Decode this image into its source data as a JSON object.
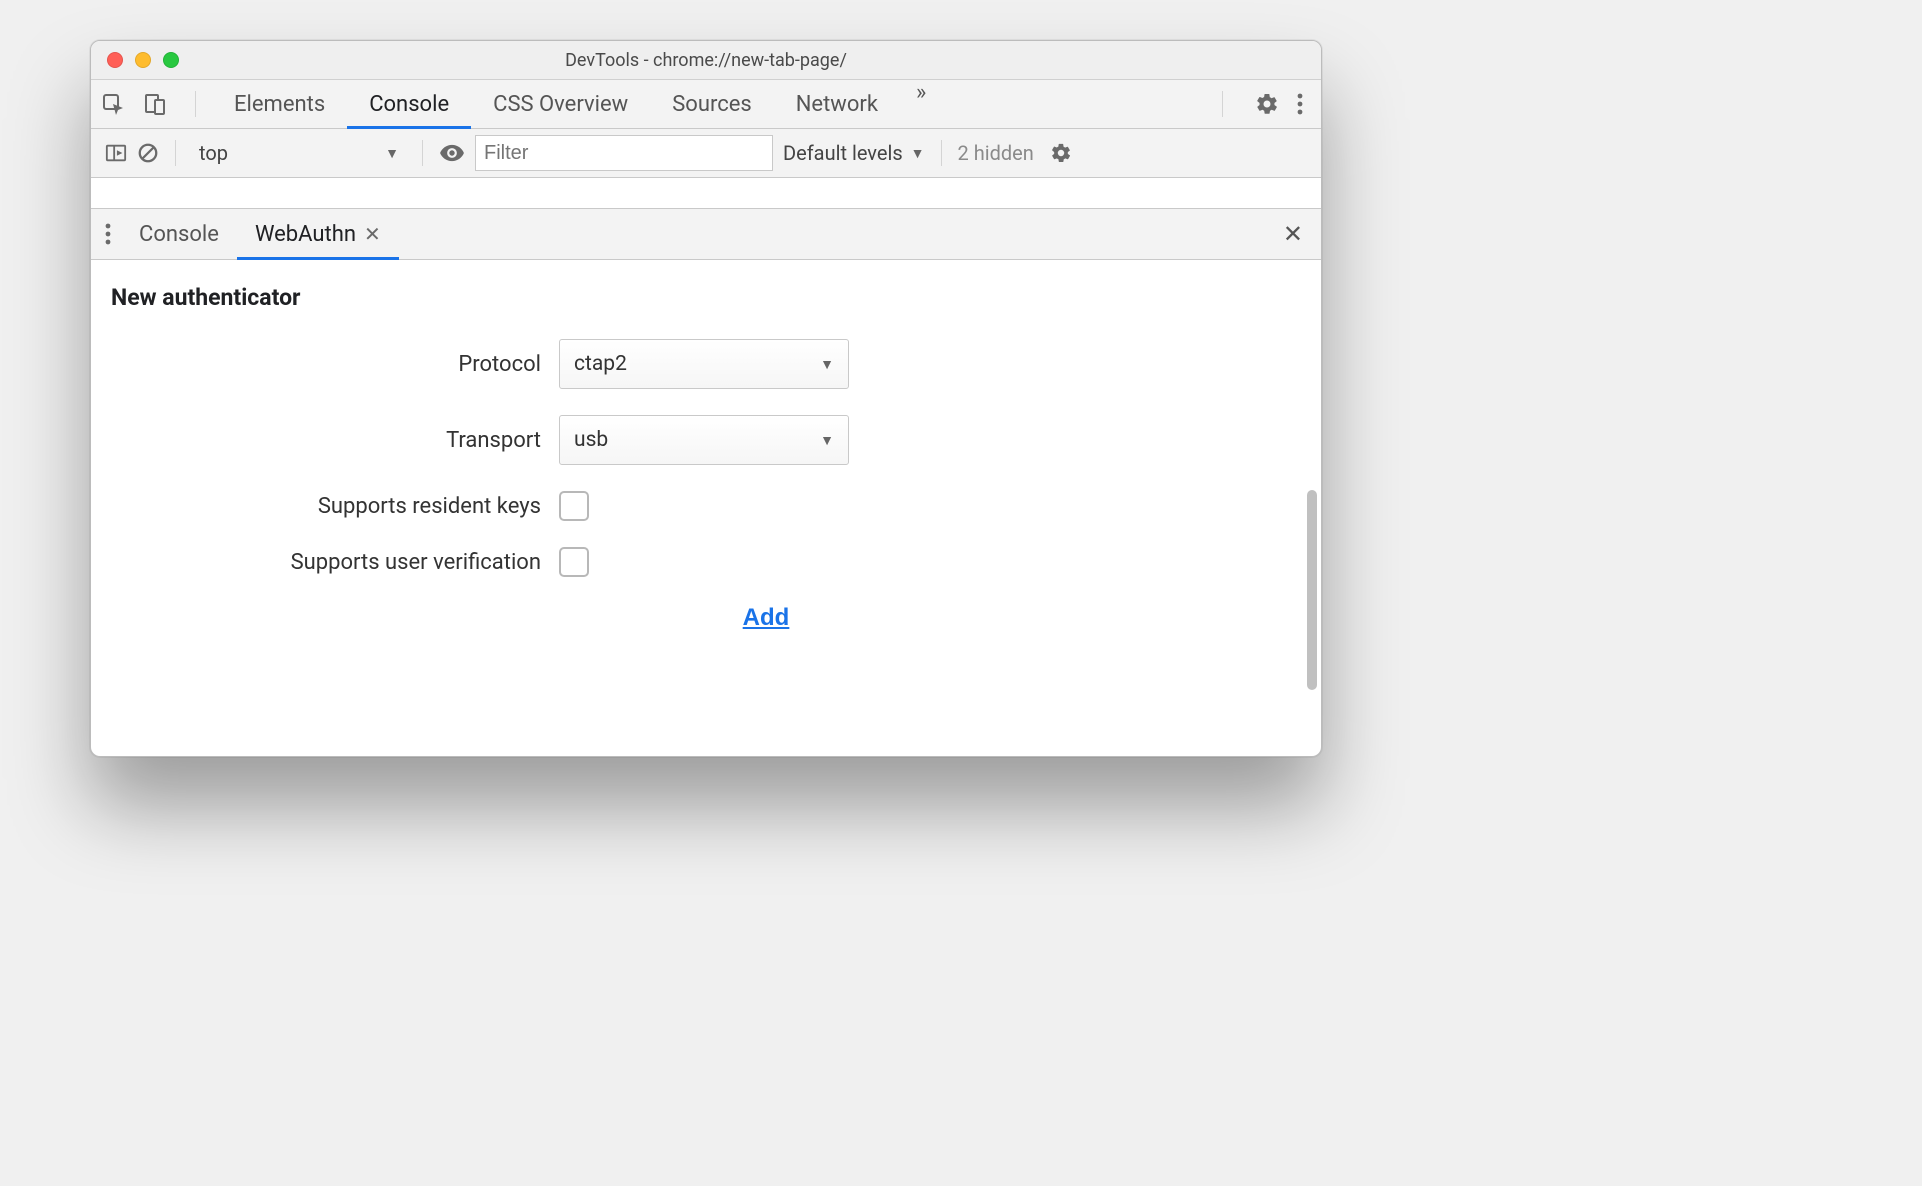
{
  "window": {
    "title": "DevTools - chrome://new-tab-page/"
  },
  "main_tabs": {
    "items": [
      "Elements",
      "Console",
      "CSS Overview",
      "Sources",
      "Network"
    ],
    "active_index": 1
  },
  "console_toolbar": {
    "context": "top",
    "filter_placeholder": "Filter",
    "levels": "Default levels",
    "hidden": "2 hidden"
  },
  "drawer_tabs": {
    "items": [
      "Console",
      "WebAuthn"
    ],
    "active_index": 1
  },
  "webauthn": {
    "heading": "New authenticator",
    "labels": {
      "protocol": "Protocol",
      "transport": "Transport",
      "resident_keys": "Supports resident keys",
      "user_verification": "Supports user verification"
    },
    "values": {
      "protocol": "ctap2",
      "transport": "usb",
      "resident_keys": false,
      "user_verification": false
    },
    "add_label": "Add"
  }
}
